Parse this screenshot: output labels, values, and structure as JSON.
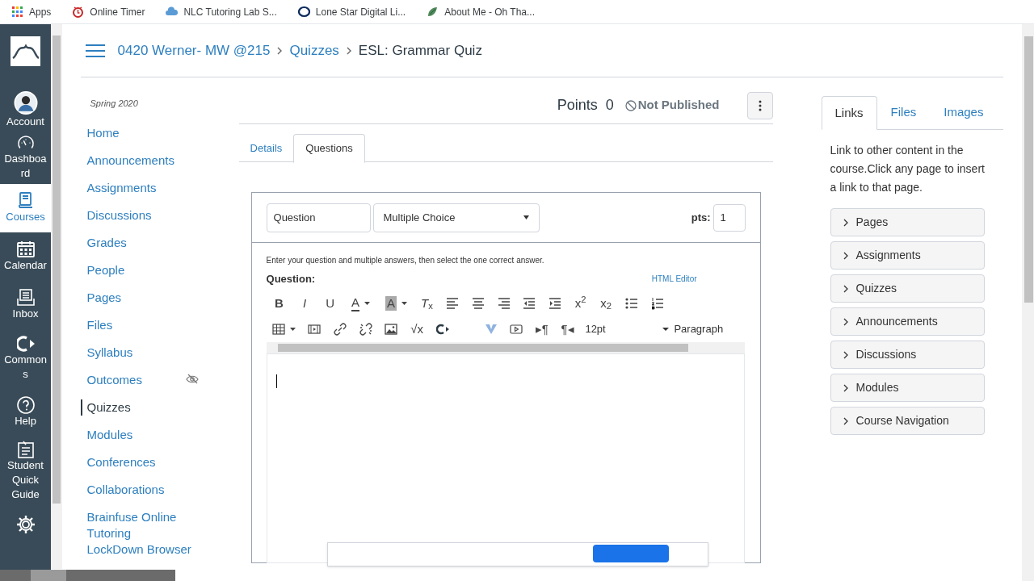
{
  "bookmarks": [
    {
      "label": "Apps"
    },
    {
      "label": "Online Timer"
    },
    {
      "label": "NLC Tutoring Lab S..."
    },
    {
      "label": "Lone Star Digital Li..."
    },
    {
      "label": "About Me - Oh Tha..."
    }
  ],
  "global_nav": [
    {
      "label": "Account",
      "selected": false
    },
    {
      "label": "Dashboa rd",
      "selected": false
    },
    {
      "label": "Courses",
      "selected": true
    },
    {
      "label": "Calendar",
      "selected": false
    },
    {
      "label": "Inbox",
      "selected": false
    },
    {
      "label": "Common s",
      "selected": false
    },
    {
      "label": "Help",
      "selected": false
    },
    {
      "label": "Student Quick Guide",
      "selected": false
    }
  ],
  "breadcrumb": [
    "0420 Werner- MW @215",
    "Quizzes",
    "ESL: Grammar Quiz"
  ],
  "term": "Spring 2020",
  "course_nav": [
    {
      "label": "Home",
      "selected": false,
      "hidden": false
    },
    {
      "label": "Announcements",
      "selected": false,
      "hidden": false
    },
    {
      "label": "Assignments",
      "selected": false,
      "hidden": false
    },
    {
      "label": "Discussions",
      "selected": false,
      "hidden": false
    },
    {
      "label": "Grades",
      "selected": false,
      "hidden": false
    },
    {
      "label": "People",
      "selected": false,
      "hidden": false
    },
    {
      "label": "Pages",
      "selected": false,
      "hidden": false
    },
    {
      "label": "Files",
      "selected": false,
      "hidden": false
    },
    {
      "label": "Syllabus",
      "selected": false,
      "hidden": false
    },
    {
      "label": "Outcomes",
      "selected": false,
      "hidden": true
    },
    {
      "label": "Quizzes",
      "selected": true,
      "hidden": false
    },
    {
      "label": "Modules",
      "selected": false,
      "hidden": false
    },
    {
      "label": "Conferences",
      "selected": false,
      "hidden": false
    },
    {
      "label": "Collaborations",
      "selected": false,
      "hidden": false
    },
    {
      "label": "Brainfuse Online Tutoring",
      "selected": false,
      "hidden": false
    },
    {
      "label": "LockDown Browser",
      "selected": false,
      "hidden": false
    }
  ],
  "quiz_header": {
    "points_label": "Points",
    "points": "0",
    "status": "Not Published"
  },
  "tabs": [
    {
      "label": "Details",
      "selected": false
    },
    {
      "label": "Questions",
      "selected": true
    }
  ],
  "question": {
    "name": "Question",
    "type": "Multiple Choice",
    "pts_label": "pts:",
    "pts": "1",
    "instructions": "Enter your question and multiple answers, then select the one correct answer.",
    "label": "Question:",
    "html_editor": "HTML Editor",
    "toolbar_rows": [
      [
        {
          "kind": "glyph",
          "text": "**B**"
        },
        {
          "kind": "glyph",
          "text": "*I*"
        },
        {
          "kind": "glyph",
          "text": "U"
        },
        {
          "kind": "glyph",
          "text": "A",
          "caret": true
        },
        {
          "kind": "shaded",
          "text": "A",
          "caret": true
        },
        {
          "kind": "glyph",
          "text": "*T*$_{x}$"
        },
        {
          "kind": "icon"
        },
        {
          "kind": "icon"
        },
        {
          "kind": "icon"
        },
        {
          "kind": "icon"
        },
        {
          "kind": "icon"
        },
        {
          "kind": "glyph",
          "text": "x$^{2}$"
        },
        {
          "kind": "glyph",
          "text": "x$_{2}$"
        },
        {
          "kind": "icon"
        },
        {
          "kind": "icon"
        }
      ],
      [
        {
          "kind": "icon",
          "caret": true
        },
        {
          "kind": "icon"
        },
        {
          "kind": "icon"
        },
        {
          "kind": "icon"
        },
        {
          "kind": "icon"
        },
        {
          "kind": "glyph",
          "text": "√x"
        },
        {
          "kind": "icon"
        },
        {
          "kind": "gap"
        },
        {
          "kind": "icon"
        },
        {
          "kind": "icon"
        },
        {
          "kind": "glyph",
          "text": "▸¶"
        },
        {
          "kind": "glyph",
          "text": "¶◂"
        },
        {
          "kind": "select",
          "text": "12pt",
          "caret": true
        },
        {
          "kind": "select",
          "text": "Paragraph"
        }
      ]
    ]
  },
  "right_panel": {
    "tabs": [
      {
        "label": "Links",
        "selected": true
      },
      {
        "label": "Files",
        "selected": false
      },
      {
        "label": "Images",
        "selected": false
      }
    ],
    "description": "Link to other content in the course.Click any page to insert a link to that page.",
    "sections": [
      {
        "label": "Pages",
        "expanded": false
      },
      {
        "label": "Assignments",
        "expanded": false
      },
      {
        "label": "Quizzes",
        "expanded": false
      },
      {
        "label": "Announcements",
        "expanded": false
      },
      {
        "label": "Discussions",
        "expanded": false
      },
      {
        "label": "Modules",
        "expanded": false
      },
      {
        "label": "Course Navigation",
        "expanded": false
      }
    ]
  }
}
